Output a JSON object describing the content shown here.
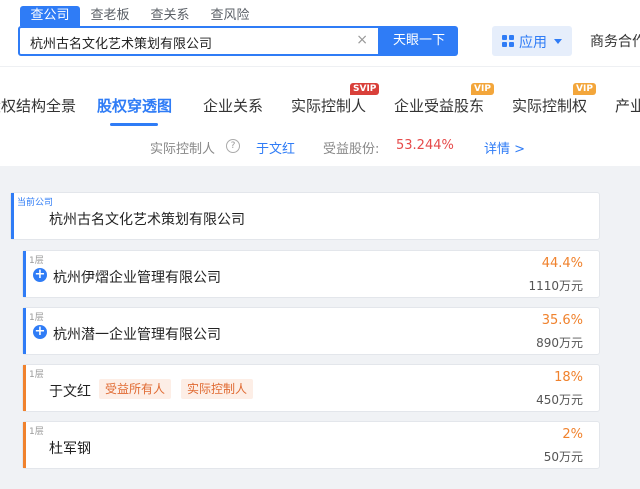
{
  "search": {
    "tabs": [
      "查公司",
      "查老板",
      "查关系",
      "查风险"
    ],
    "query": "杭州古名文化艺术策划有限公司",
    "clear_icon": "×",
    "button": "天眼一下"
  },
  "header": {
    "app_label": "应用",
    "business_label": "商务合作"
  },
  "nav": {
    "items": [
      "股权结构全景",
      "股权穿透图",
      "企业关系",
      "实际控制人",
      "企业受益股东",
      "实际控制权",
      "产业"
    ],
    "badges": {
      "svip": "SVIP",
      "vip1": "VIP",
      "vip2": "VIP"
    }
  },
  "summary": {
    "controller_label": "实际控制人",
    "help_icon": "?",
    "controller_name": "于文红",
    "share_label": "受益股份:",
    "share_value": "53.244%",
    "detail_link": "详情 >"
  },
  "current": {
    "tag": "当前公司",
    "name": "杭州古名文化艺术策划有限公司"
  },
  "shareholders": [
    {
      "level": "1层",
      "name": "杭州伊熠企业管理有限公司",
      "percent": "44.4%",
      "amount": "1110万元",
      "expandable": true
    },
    {
      "level": "1层",
      "name": "杭州潜一企业管理有限公司",
      "percent": "35.6%",
      "amount": "890万元",
      "expandable": true
    },
    {
      "level": "1层",
      "name": "于文红",
      "percent": "18%",
      "amount": "450万元",
      "tags": [
        "受益所有人",
        "实际控制人"
      ]
    },
    {
      "level": "1层",
      "name": "杜军钢",
      "percent": "2%",
      "amount": "50万元"
    }
  ],
  "colors": {
    "accent": "#2f7cf6",
    "orange": "#f0822d",
    "percent_red": "#e64a4a"
  }
}
